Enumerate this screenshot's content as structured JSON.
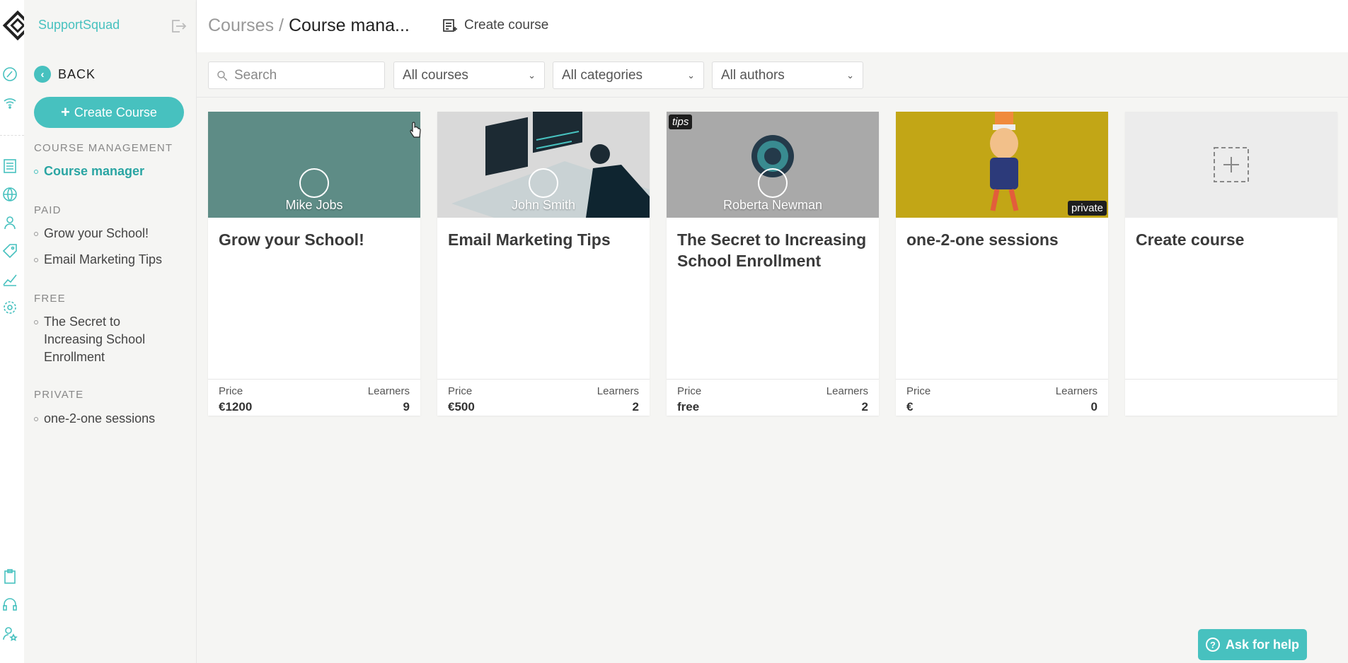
{
  "brand": {
    "name": "SupportSquad"
  },
  "sidebar": {
    "back_label": "BACK",
    "create_label": "Create Course",
    "sections": [
      {
        "title": "COURSE MANAGEMENT",
        "items": [
          "Course manager"
        ]
      },
      {
        "title": "PAID",
        "items": [
          "Grow your School!",
          "Email Marketing Tips"
        ]
      },
      {
        "title": "FREE",
        "items": [
          "The Secret to Increasing School Enrollment"
        ]
      },
      {
        "title": "PRIVATE",
        "items": [
          "one-2-one sessions"
        ]
      }
    ]
  },
  "header": {
    "breadcrumb_root": "Courses",
    "breadcrumb_sep": "/",
    "breadcrumb_current": "Course mana...",
    "create_label": "Create course"
  },
  "filters": {
    "search_placeholder": "Search",
    "courses": "All courses",
    "categories": "All categories",
    "authors": "All authors"
  },
  "cards": [
    {
      "title": "Grow your School!",
      "author": "Mike Jobs",
      "price_label": "Price",
      "price": "€1200",
      "learners_label": "Learners",
      "learners": "9",
      "badge": "",
      "thumb_color": "#5e8c86"
    },
    {
      "title": "Email Marketing Tips",
      "author": "John Smith",
      "price_label": "Price",
      "price": "€500",
      "learners_label": "Learners",
      "learners": "2",
      "badge": "",
      "thumb_color": "#d9d9d9"
    },
    {
      "title": "The Secret to Increasing School Enrollment",
      "author": "Roberta Newman",
      "price_label": "Price",
      "price": "free",
      "learners_label": "Learners",
      "learners": "2",
      "badge": "tips",
      "thumb_color": "#a9a9a9"
    },
    {
      "title": "one-2-one sessions",
      "author": "",
      "price_label": "Price",
      "price": "€",
      "learners_label": "Learners",
      "learners": "0",
      "badge": "private",
      "thumb_color": "#c2a616"
    },
    {
      "title": "Create course"
    }
  ],
  "help": {
    "label": "Ask for help"
  },
  "colors": {
    "accent": "#47c1bf",
    "accent_dark": "#2aa5a3",
    "background": "#f5f5f3"
  }
}
